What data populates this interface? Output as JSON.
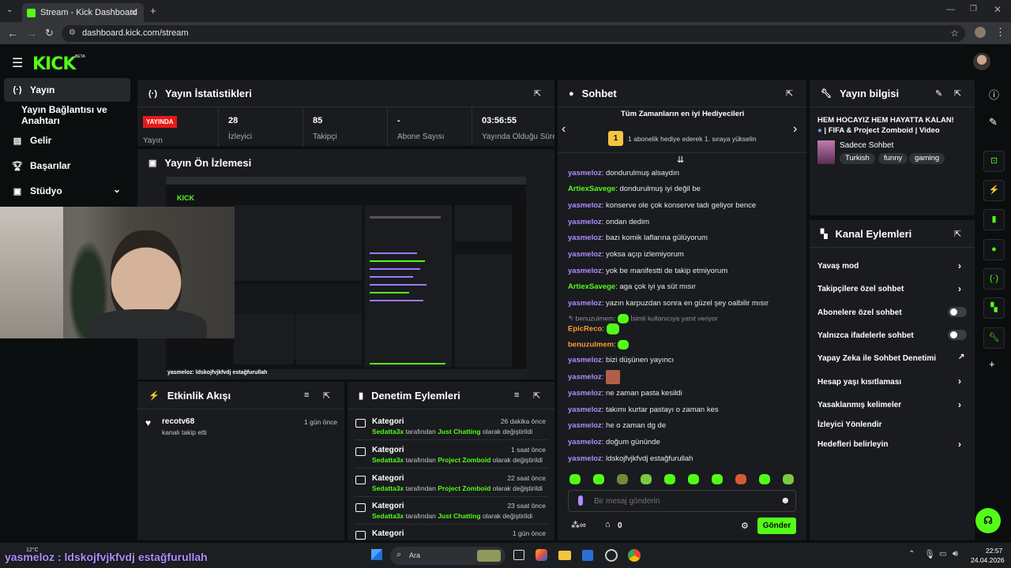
{
  "browser": {
    "tab_title": "Stream - Kick Dashboard",
    "url": "dashboard.kick.com/stream"
  },
  "app": {
    "logo": "KICK",
    "logo_badge": "BETA"
  },
  "sidebar": {
    "items": [
      {
        "label": "Yayın"
      },
      {
        "label": "Yayın Bağlantısı ve Anahtarı"
      },
      {
        "label": "Gelir"
      },
      {
        "label": "Başarılar"
      },
      {
        "label": "Stüdyo"
      }
    ]
  },
  "stats": {
    "title": "Yayın İstatistikleri",
    "live_badge": "YAYINDA",
    "live_label": "Yayın",
    "items": [
      {
        "value": "28",
        "label": "İzleyici"
      },
      {
        "value": "85",
        "label": "Takipçi"
      },
      {
        "value": "-",
        "label": "Abone Sayısı"
      },
      {
        "value": "03:56:55",
        "label": "Yayında Olduğu Süre"
      }
    ]
  },
  "preview": {
    "title": "Yayın Ön İzlemesi",
    "overlay_chat_line": "yasmeloz: ldskojfvjkfvdj estağfurullah"
  },
  "activity": {
    "title": "Etkinlik Akışı",
    "items": [
      {
        "user": "recotv68",
        "text": "kanalı takip etti",
        "time": "1 gün önce"
      }
    ]
  },
  "moderation": {
    "title": "Denetim Eylemleri",
    "items": [
      {
        "title": "Kategori",
        "mod": "Sedatta3x",
        "mid": "tarafından",
        "cat": "Just Chatting",
        "end": "olarak değiştirildi",
        "time": "26 dakika önce"
      },
      {
        "title": "Kategori",
        "mod": "Sedatta3x",
        "mid": "tarafından",
        "cat": "Project Zomboid",
        "end": "olarak değiştirildi",
        "time": "1 saat önce"
      },
      {
        "title": "Kategori",
        "mod": "Sedatta3x",
        "mid": "tarafından",
        "cat": "Project Zomboid",
        "end": "olarak değiştirildi",
        "time": "22 saat önce"
      },
      {
        "title": "Kategori",
        "mod": "Sedatta3x",
        "mid": "tarafından",
        "cat": "Just Chatting",
        "end": "olarak değiştirildi",
        "time": "23 saat önce"
      },
      {
        "title": "Kategori",
        "time": "1 gün önce"
      }
    ]
  },
  "chat": {
    "title": "Sohbet",
    "gifters_title": "Tüm Zamanların en iyi Hediyecileri",
    "gifter_rank": "1",
    "gifter_text": "1 abonelik hediye ederek 1. sıraya yükselin",
    "messages": [
      {
        "user": "yasmeloz",
        "color": "#b18cff",
        "text": ": dondurulmuş alsaydın"
      },
      {
        "user": "ArtiexSavege",
        "color": "#53fc18",
        "text": ": dondurulmuş iyi değil be"
      },
      {
        "user": "yasmeloz",
        "color": "#b18cff",
        "text": ": konserve ole çok konserve tadı geliyor bence"
      },
      {
        "user": "yasmeloz",
        "color": "#b18cff",
        "text": ": ondan dedim"
      },
      {
        "user": "yasmeloz",
        "color": "#b18cff",
        "text": ": bazı komik laflarına gülüyorum"
      },
      {
        "user": "yasmeloz",
        "color": "#b18cff",
        "text": ": yoksa açıp izlemiyorum"
      },
      {
        "user": "yasmeloz",
        "color": "#b18cff",
        "text": ": yok be manifestti de takip etmiyorum"
      },
      {
        "user": "ArtiexSavege",
        "color": "#53fc18",
        "text": ": aga çok iyi ya süt mısır"
      },
      {
        "user": "yasmeloz",
        "color": "#b18cff",
        "text": ": yazın karpuzdan sonra en güzel şey oalbilir mısır"
      }
    ],
    "reply_to": "benuzulmem:",
    "reply_note": "İsimli kullanıcıya yanıt veriyor",
    "messages2": [
      {
        "user": "EpicReco",
        "color": "#ff9b2f",
        "text": ":"
      },
      {
        "user": "benuzulmem",
        "color": "#ff9b2f",
        "text": ":"
      },
      {
        "user": "yasmeloz",
        "color": "#b18cff",
        "text": ": bizi düşünen yayıncı"
      },
      {
        "user": "yasmeloz",
        "color": "#b18cff",
        "text": ":"
      },
      {
        "user": "yasmeloz",
        "color": "#b18cff",
        "text": ": ne zaman pasta kesildi"
      },
      {
        "user": "yasmeloz",
        "color": "#b18cff",
        "text": ": takımı kurtar pastayı o zaman kes"
      },
      {
        "user": "yasmeloz",
        "color": "#b18cff",
        "text": ": he o zaman dg de"
      },
      {
        "user": "yasmeloz",
        "color": "#b18cff",
        "text": ": doğum gününde"
      },
      {
        "user": "yasmeloz",
        "color": "#b18cff",
        "text": ": ldskojfvjkfvdj estağfurullah"
      }
    ],
    "input_placeholder": "Bir mesaj gönderin",
    "points": "0",
    "send_label": "Gönder"
  },
  "info": {
    "title": "Yayın bilgisi",
    "stream_title_line1": "HEM HOCAYIZ HEM HAYATTA KALAN!",
    "stream_title_line2": "| FIFA & Project Zomboid | Video",
    "category": "Sadece Sohbet",
    "tags": [
      "Turkish",
      "funny",
      "gaming"
    ]
  },
  "channel_actions": {
    "title": "Kanal Eylemleri",
    "items": [
      {
        "label": "Yavaş mod"
      },
      {
        "label": "Takipçilere özel sohbet"
      },
      {
        "label": "Abonelere özel sohbet"
      },
      {
        "label": "Yalnızca ifadelerle sohbet"
      },
      {
        "label": "Yapay Zeka ile Sohbet Denetimi"
      },
      {
        "label": "Hesap yaşı kısıtlaması"
      },
      {
        "label": "Yasaklanmış kelimeler"
      },
      {
        "label": "İzleyici Yönlendir"
      },
      {
        "label": "Hedefleri belirleyin"
      }
    ]
  },
  "overlay": {
    "subtitle": "yasmeloz : ldskojfvjkfvdj estağfurullah"
  },
  "taskbar": {
    "temp": "12°C",
    "search_placeholder": "Ara",
    "time": "22:57",
    "date": "24.04.2026"
  }
}
